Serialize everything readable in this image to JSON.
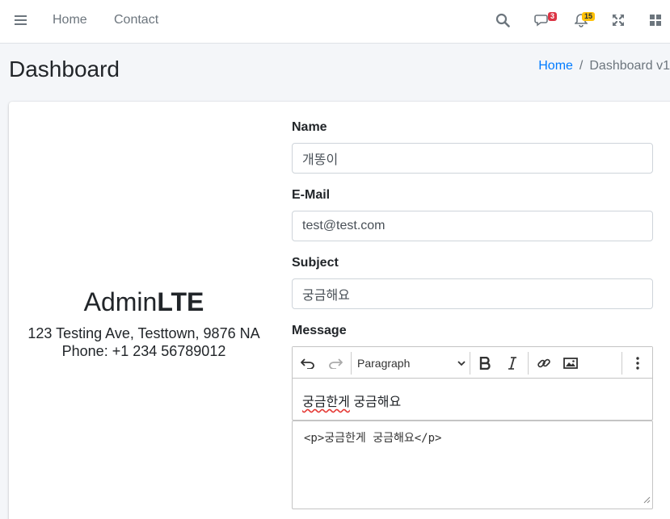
{
  "navbar": {
    "links": [
      {
        "label": "Home"
      },
      {
        "label": "Contact"
      }
    ],
    "icons": [
      "bars-icon",
      "search-icon",
      "comments-icon",
      "bell-icon",
      "expand-icon",
      "th-large-icon"
    ],
    "messages_badge": "3",
    "notifications_badge": "15"
  },
  "header": {
    "title": "Dashboard",
    "breadcrumb": [
      {
        "label": "Home"
      },
      {
        "label": "Dashboard v1"
      }
    ],
    "breadcrumb_separator": "/"
  },
  "contact": {
    "brand_light": "Admin",
    "brand_bold": "LTE",
    "address_line1": "123 Testing Ave, Testtown, 9876 NA",
    "address_line2": "Phone: +1 234 56789012"
  },
  "form": {
    "name_label": "Name",
    "name_value": "개똥이",
    "email_label": "E-Mail",
    "email_value": "test@test.com",
    "subject_label": "Subject",
    "subject_value": "궁금해요",
    "message_label": "Message",
    "editor": {
      "heading_select": "Paragraph",
      "content_misspelled": "궁금한게",
      "content_rest": " 궁금해요",
      "source": "<p>궁금한게 궁금해요</p>"
    }
  },
  "colors": {
    "link": "#007bff",
    "badge_danger": "#dc3545",
    "badge_warning": "#ffc107"
  }
}
